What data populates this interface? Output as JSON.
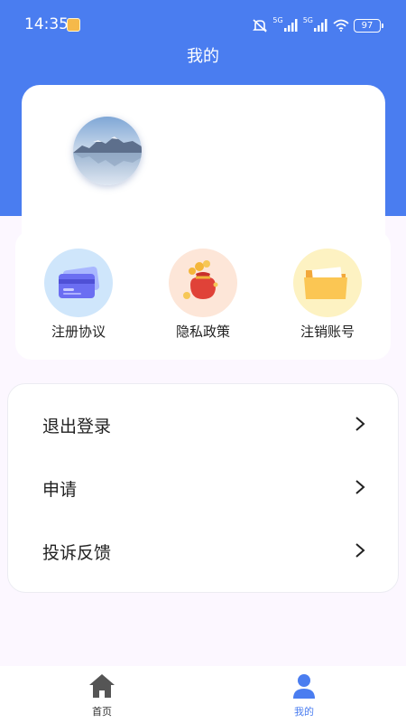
{
  "status_bar": {
    "time": "14:35",
    "network_label_1": "5G",
    "network_label_2": "5G",
    "battery": "97"
  },
  "header": {
    "title": "我的",
    "background_color": "#4a7df0"
  },
  "profile": {
    "avatar_icon": "mountain-lake-photo"
  },
  "quick_actions": [
    {
      "label": "注册协议",
      "icon": "card-icon",
      "bg_color": "#cfe6fb"
    },
    {
      "label": "隐私政策",
      "icon": "money-bag-icon",
      "bg_color": "#fde6d8"
    },
    {
      "label": "注销账号",
      "icon": "folder-icon",
      "bg_color": "#fdf2c2"
    }
  ],
  "menu": [
    {
      "label": "退出登录",
      "icon": "chevron-right-icon"
    },
    {
      "label": "申请",
      "icon": "chevron-right-icon"
    },
    {
      "label": "投诉反馈",
      "icon": "chevron-right-icon"
    }
  ],
  "tab_bar": {
    "tabs": [
      {
        "label": "首页",
        "icon": "home-icon",
        "active": false,
        "color": "#333333"
      },
      {
        "label": "我的",
        "icon": "person-icon",
        "active": true,
        "color": "#4a7df0"
      }
    ]
  }
}
